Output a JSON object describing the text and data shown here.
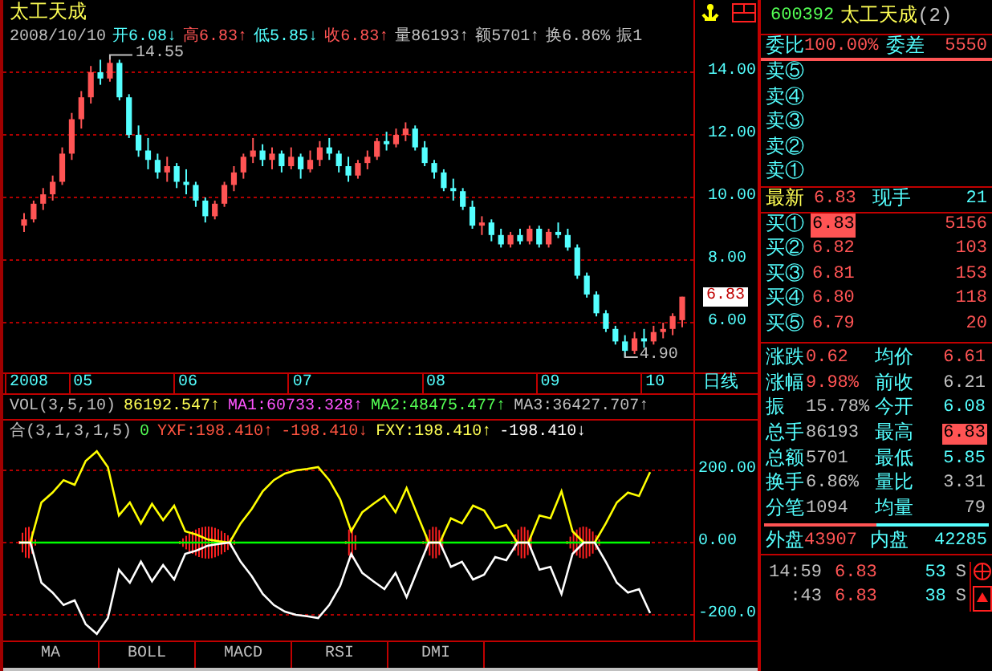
{
  "title": "太工天成",
  "info": [
    {
      "text": "2008/10/10",
      "color": "#c0c0c0"
    },
    {
      "text": "开6.08↓",
      "color": "#54ffff"
    },
    {
      "text": "高6.83↑",
      "color": "#ff5454"
    },
    {
      "text": "低5.85↓",
      "color": "#54ffff"
    },
    {
      "text": "收6.83↑",
      "color": "#ff5454"
    },
    {
      "text": "量86193↑",
      "color": "#c0c0c0"
    },
    {
      "text": "额5701↑",
      "color": "#c0c0c0"
    },
    {
      "text": "换6.86%",
      "color": "#c0c0c0"
    },
    {
      "text": "振1",
      "color": "#c0c0c0"
    }
  ],
  "price_chart": {
    "high_label": "14.55",
    "low_label": "4.90",
    "current_price": "6.83",
    "chart_data": {
      "type": "candlestick",
      "ylim": [
        4.41,
        14.77
      ],
      "grid": true,
      "yticks": [
        {
          "value": 14,
          "label": "14.00"
        },
        {
          "value": 12,
          "label": "12.00"
        },
        {
          "value": 10,
          "label": "10.00"
        },
        {
          "value": 8,
          "label": "8.00"
        },
        {
          "value": 6,
          "label": "6.00"
        }
      ],
      "categories": [
        "2008",
        null,
        null,
        null,
        null,
        null,
        "05",
        null,
        null,
        null,
        null,
        null,
        null,
        null,
        null,
        null,
        null,
        "06",
        null,
        null,
        null,
        null,
        null,
        null,
        null,
        null,
        null,
        null,
        null,
        "07",
        null,
        null,
        null,
        null,
        null,
        null,
        null,
        null,
        null,
        null,
        null,
        null,
        null,
        "08",
        null,
        null,
        null,
        null,
        null,
        null,
        null,
        null,
        null,
        null,
        null,
        "09",
        null,
        null,
        null,
        null,
        null,
        null,
        null,
        null,
        null,
        null,
        "10",
        null,
        null,
        null
      ],
      "ohlc": [
        [
          9.1,
          9.5,
          8.9,
          9.3
        ],
        [
          9.3,
          9.9,
          9.2,
          9.8
        ],
        [
          9.8,
          10.3,
          9.6,
          10.1
        ],
        [
          10.1,
          10.7,
          9.9,
          10.5
        ],
        [
          10.5,
          11.6,
          10.4,
          11.4
        ],
        [
          11.4,
          12.7,
          11.2,
          12.5
        ],
        [
          12.5,
          13.4,
          12.2,
          13.2
        ],
        [
          13.2,
          14.2,
          13.0,
          14.0
        ],
        [
          14.0,
          14.4,
          13.6,
          13.8
        ],
        [
          13.8,
          14.55,
          13.7,
          14.3
        ],
        [
          14.3,
          14.4,
          13.1,
          13.2
        ],
        [
          13.2,
          13.3,
          11.9,
          12.0
        ],
        [
          12.0,
          12.3,
          11.3,
          11.5
        ],
        [
          11.5,
          11.9,
          10.9,
          11.2
        ],
        [
          11.2,
          11.4,
          10.6,
          10.8
        ],
        [
          10.8,
          11.3,
          10.5,
          11.0
        ],
        [
          11.0,
          11.1,
          10.3,
          10.5
        ],
        [
          10.5,
          10.9,
          10.1,
          10.4
        ],
        [
          10.4,
          10.5,
          9.7,
          9.9
        ],
        [
          9.9,
          10.0,
          9.2,
          9.4
        ],
        [
          9.4,
          9.9,
          9.3,
          9.8
        ],
        [
          9.8,
          10.5,
          9.7,
          10.4
        ],
        [
          10.4,
          11.0,
          10.2,
          10.8
        ],
        [
          10.8,
          11.4,
          10.6,
          11.3
        ],
        [
          11.3,
          11.9,
          11.1,
          11.5
        ],
        [
          11.5,
          11.7,
          11.0,
          11.2
        ],
        [
          11.2,
          11.6,
          10.9,
          11.4
        ],
        [
          11.4,
          11.5,
          10.8,
          11.0
        ],
        [
          11.0,
          11.6,
          10.9,
          11.3
        ],
        [
          11.3,
          11.4,
          10.6,
          10.9
        ],
        [
          10.9,
          11.5,
          10.8,
          11.2
        ],
        [
          11.2,
          11.8,
          11.0,
          11.6
        ],
        [
          11.6,
          11.9,
          11.2,
          11.4
        ],
        [
          11.4,
          11.5,
          10.8,
          11.0
        ],
        [
          11.0,
          11.3,
          10.5,
          10.7
        ],
        [
          10.7,
          11.2,
          10.6,
          11.1
        ],
        [
          11.1,
          11.5,
          10.9,
          11.3
        ],
        [
          11.3,
          11.9,
          11.2,
          11.8
        ],
        [
          11.8,
          12.1,
          11.5,
          11.7
        ],
        [
          11.7,
          12.2,
          11.6,
          12.0
        ],
        [
          12.0,
          12.4,
          11.8,
          12.2
        ],
        [
          12.2,
          12.3,
          11.5,
          11.6
        ],
        [
          11.6,
          11.8,
          11.0,
          11.1
        ],
        [
          11.1,
          11.2,
          10.6,
          10.8
        ],
        [
          10.8,
          10.9,
          10.2,
          10.3
        ],
        [
          10.3,
          10.6,
          9.9,
          10.2
        ],
        [
          10.2,
          10.3,
          9.6,
          9.7
        ],
        [
          9.7,
          9.9,
          9.0,
          9.1
        ],
        [
          9.1,
          9.4,
          8.8,
          9.2
        ],
        [
          9.2,
          9.3,
          8.6,
          8.8
        ],
        [
          8.8,
          9.0,
          8.4,
          8.5
        ],
        [
          8.5,
          8.9,
          8.4,
          8.8
        ],
        [
          8.8,
          9.0,
          8.5,
          8.6
        ],
        [
          8.6,
          9.1,
          8.5,
          9.0
        ],
        [
          9.0,
          9.1,
          8.4,
          8.5
        ],
        [
          8.5,
          9.0,
          8.4,
          8.9
        ],
        [
          8.9,
          9.2,
          8.7,
          8.8
        ],
        [
          8.8,
          9.0,
          8.3,
          8.4
        ],
        [
          8.4,
          8.5,
          7.4,
          7.5
        ],
        [
          7.5,
          7.6,
          6.8,
          6.9
        ],
        [
          6.9,
          7.0,
          6.2,
          6.3
        ],
        [
          6.3,
          6.4,
          5.7,
          5.8
        ],
        [
          5.8,
          5.9,
          5.3,
          5.4
        ],
        [
          5.4,
          5.6,
          4.9,
          5.1
        ],
        [
          5.1,
          5.7,
          5.0,
          5.5
        ],
        [
          5.5,
          5.8,
          5.2,
          5.4
        ],
        [
          5.4,
          5.9,
          5.3,
          5.7
        ],
        [
          5.7,
          6.0,
          5.5,
          5.8
        ],
        [
          5.8,
          6.3,
          5.6,
          6.21
        ],
        [
          6.08,
          6.83,
          5.85,
          6.83
        ]
      ]
    }
  },
  "period": "日线",
  "volume_row": [
    {
      "text": "VOL(3,5,10)",
      "color": "#c0c0c0"
    },
    {
      "text": "86192.547↑",
      "color": "#ffff54"
    },
    {
      "text": "MA1:60733.328↑",
      "color": "#ff54ff"
    },
    {
      "text": "MA2:48475.477↑",
      "color": "#54ff54"
    },
    {
      "text": "MA3:36427.707↑",
      "color": "#c0c0c0"
    }
  ],
  "indicator_row": [
    {
      "kind": "text",
      "text": "合(3,1,3,1,5)",
      "color": "#c0c0c0"
    },
    {
      "kind": "text",
      "text": "0",
      "color": "#54ff54"
    },
    {
      "kind": "series",
      "text": ":198.410↑",
      "color": "#ff5440"
    },
    {
      "kind": "text",
      "text": "-198.410↓",
      "color": "#ff5440"
    },
    {
      "kind": "series",
      "text": ":198.410↑",
      "color": "#ffff54"
    },
    {
      "kind": "text",
      "text": "-198.410↓",
      "color": "#ffffff"
    }
  ],
  "indicator_chart": {
    "chart_data": {
      "type": "line",
      "grid": true,
      "ylim": [
        -271,
        271
      ],
      "yticks": [
        {
          "value": 200,
          "label": "200.00"
        },
        {
          "value": 0,
          "label": "0.00"
        },
        {
          "value": -200,
          "label": "-200.0"
        }
      ],
      "series": [
        {
          "name": "YXF",
          "color": "#ffff00",
          "values": [
            0,
            0,
            111,
            138,
            173,
            160,
            226,
            253,
            209,
            75,
            111,
            53,
            107,
            62,
            102,
            31,
            22,
            9,
            4,
            0,
            53,
            93,
            142,
            173,
            191,
            200,
            204,
            209,
            173,
            120,
            31,
            84,
            107,
            129,
            84,
            151,
            75,
            0,
            0,
            67,
            53,
            102,
            89,
            40,
            49,
            0,
            0,
            75,
            67,
            142,
            31,
            0,
            0,
            53,
            111,
            138,
            129,
            195
          ]
        },
        {
          "color": "#00ff00",
          "values": [
            0,
            0,
            0,
            0,
            0,
            0,
            0,
            0,
            0,
            0,
            0,
            0,
            0,
            0,
            0,
            0,
            0,
            0,
            0,
            0,
            0,
            0,
            0,
            0,
            0,
            0,
            0,
            0,
            0,
            0,
            0,
            0,
            0,
            0,
            0,
            0,
            0,
            0,
            0,
            0,
            0,
            0,
            0,
            0,
            0,
            0,
            0,
            0,
            0,
            0,
            0,
            0,
            0,
            0,
            0,
            0,
            0,
            0
          ]
        },
        {
          "name": "FXY",
          "color": "#ffffff",
          "values": [
            0,
            0,
            -111,
            -138,
            -173,
            -160,
            -226,
            -253,
            -209,
            -75,
            -111,
            -53,
            -107,
            -62,
            -102,
            -31,
            -22,
            -9,
            -4,
            0,
            -53,
            -93,
            -142,
            -173,
            -191,
            -200,
            -204,
            -209,
            -173,
            -120,
            -31,
            -84,
            -107,
            -129,
            -84,
            -151,
            -75,
            0,
            0,
            -67,
            -53,
            -102,
            -89,
            -40,
            -49,
            0,
            0,
            -75,
            -67,
            -142,
            -31,
            0,
            0,
            -53,
            -111,
            -138,
            -129,
            -195
          ]
        }
      ]
    }
  },
  "tabs": [
    "MA",
    "BOLL",
    "MACD",
    "RSI",
    "DMI"
  ],
  "quote": {
    "code": "600392",
    "name": "太工天成",
    "suffix": "(2)",
    "ratio": {
      "label": "委比",
      "value": "100.00%",
      "diff_label": "委差",
      "diff": "5550"
    },
    "sells": [
      {
        "label": "卖⑤"
      },
      {
        "label": "卖④"
      },
      {
        "label": "卖③"
      },
      {
        "label": "卖②"
      },
      {
        "label": "卖①"
      }
    ],
    "last": {
      "label": "最新",
      "price": "6.83",
      "hand_label": "现手",
      "hand": "21"
    },
    "buys": [
      {
        "label": "买①",
        "price": "6.83",
        "volume": "5156",
        "highlighted": true
      },
      {
        "label": "买②",
        "price": "6.82",
        "volume": "103",
        "highlighted": false
      },
      {
        "label": "买③",
        "price": "6.81",
        "volume": "153",
        "highlighted": false
      },
      {
        "label": "买④",
        "price": "6.80",
        "volume": "118",
        "highlighted": false
      },
      {
        "label": "买⑤",
        "price": "6.79",
        "volume": "20",
        "highlighted": false
      }
    ],
    "stats": [
      {
        "label": "涨跌",
        "value": "0.62",
        "color": "#ff5454",
        "highlighted": false
      },
      {
        "label": "均价",
        "value": "6.61",
        "color": "#ff5454",
        "highlighted": false
      },
      {
        "label": "涨幅",
        "value": "9.98%",
        "color": "#ff5454",
        "highlighted": false
      },
      {
        "label": "前收",
        "value": "6.21",
        "color": "#c0c0c0",
        "highlighted": false
      },
      {
        "label": "振",
        "value": "15.78%",
        "color": "#c0c0c0",
        "highlighted": false
      },
      {
        "label": "今开",
        "value": "6.08",
        "color": "#54ffff",
        "highlighted": false
      },
      {
        "label": "总手",
        "value": "86193",
        "color": "#c0c0c0",
        "highlighted": false
      },
      {
        "label": "最高",
        "value": "6.83",
        "highlighted": true
      },
      {
        "label": "总额",
        "value": "5701",
        "color": "#c0c0c0",
        "highlighted": false
      },
      {
        "label": "最低",
        "value": "5.85",
        "color": "#54ffff",
        "highlighted": false
      },
      {
        "label": "换手",
        "value": "6.86%",
        "color": "#c0c0c0",
        "highlighted": false
      },
      {
        "label": "量比",
        "value": "3.31",
        "color": "#c0c0c0",
        "highlighted": false
      },
      {
        "label": "分笔",
        "value": "1094",
        "color": "#c0c0c0",
        "highlighted": false
      },
      {
        "label": "均量",
        "value": "79",
        "color": "#c0c0c0",
        "highlighted": false
      }
    ],
    "outer": {
      "label": "外盘",
      "value": "43907",
      "label2": "内盘",
      "value2": "42285"
    },
    "ticks": [
      {
        "time": "14:59",
        "price": "6.83",
        "volume": "53",
        "side": "S"
      },
      {
        "time": ":43",
        "price": "6.83",
        "volume": "38",
        "side": "S"
      }
    ]
  }
}
